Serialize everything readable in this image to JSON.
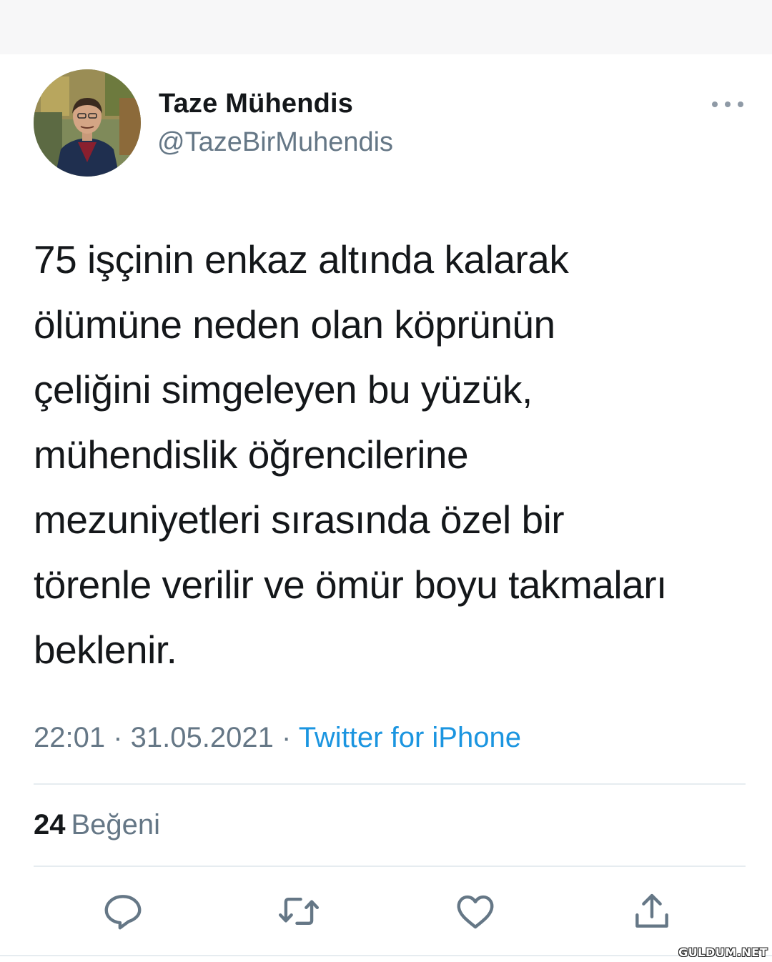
{
  "user": {
    "display_name": "Taze Mühendis",
    "handle": "@TazeBirMuhendis",
    "avatar": "profile-photo"
  },
  "tweet": {
    "lines": [
      "75 işçinin enkaz altında kalarak",
      "ölümüne neden olan köprünün",
      "çeliğini simgeleyen bu yüzük,",
      "mühendislik öğrencilerine",
      "mezuniyetleri sırasında özel bir",
      "törenle verilir ve ömür boyu takmaları",
      "beklenir."
    ]
  },
  "meta": {
    "time": "22:01",
    "separator": " · ",
    "date": "31.05.2021",
    "source": "Twitter for iPhone"
  },
  "stats": {
    "likes_count": "24",
    "likes_label": "Beğeni"
  },
  "actions": [
    {
      "name": "reply",
      "icon": "reply-icon"
    },
    {
      "name": "retweet",
      "icon": "retweet-icon"
    },
    {
      "name": "like",
      "icon": "heart-icon"
    },
    {
      "name": "share",
      "icon": "share-icon"
    }
  ],
  "colors": {
    "text": "#14171a",
    "secondary": "#657786",
    "link": "#1b95e0",
    "icon": "#657786",
    "divider": "#e6ecf0"
  },
  "watermark": "GULDUM.NET"
}
